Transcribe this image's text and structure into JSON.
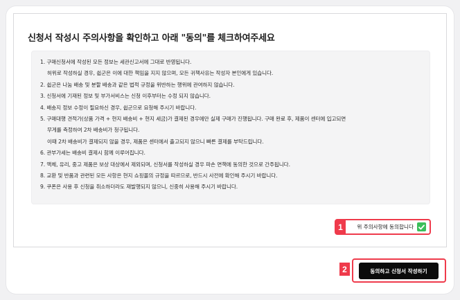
{
  "heading": "신청서 작성시 주의사항을 확인하고 아래 \"동의\"를 체크하여주세요",
  "rules": [
    {
      "line1": "1. 구매신청서에 작성된 모든 정보는 세관신고서에 그대로 반영됩니다.",
      "line2": "허위로 작성하실 경우, 쉽군은 이에 대한 책임을 지지 않으며, 모든 귀책사유는 작성자 본인에게 있습니다.",
      "line3": ""
    },
    {
      "line1": "2. 쉽군은 나눔 배송 및 분할 배송과 같은 법적 규정을 위반하는 행위에 관여하지 않습니다.",
      "line2": "",
      "line3": ""
    },
    {
      "line1": "3. 신청서에 기재된 정보 및 부가서비스는 신청 이후부터는 수정 되지 않습니다.",
      "line2": "",
      "line3": ""
    },
    {
      "line1": "4. 배송지 정보 수정이 필요하신 경우, 쉽군으로 요청해 주시기 바랍니다.",
      "line2": "",
      "line3": ""
    },
    {
      "line1": "5. 구매대행 견적가(상품 가격 + 현지 배송비 + 현지 세금)가 결제된 경우에만 실제 구매가 진행됩니다. 구매 완료 후, 제품이 센터에 입고되면",
      "line2": "무게를 측정하여 2차 배송비가 청구됩니다.",
      "line3": "이때 2차 배송비가 결제되지 않을 경우, 제품은 센터에서 출고되지 않으니 빠른 결제를 부탁드립니다."
    },
    {
      "line1": "6. 관부가세는 배송비 결제시 함께 이루어집니다.",
      "line2": "",
      "line3": ""
    },
    {
      "line1": "7. 액체, 유리, 중고 제품은 보상 대상에서 제외되며, 신청서를 작성하실 경우 파손 면책에 동의한 것으로 간주됩니다.",
      "line2": "",
      "line3": ""
    },
    {
      "line1": "8. 교환 및 반품과 관련된 모든 사항은 현지 쇼핑몰의 규정을 따르므로, 반드시 사전에 확인해 주시기 바랍니다.",
      "line2": "",
      "line3": ""
    },
    {
      "line1": "9. 쿠폰은 사용 후 신청을 취소하더라도 재발행되지 않으니, 신중히 사용해 주시기 바랍니다.",
      "line2": "",
      "line3": ""
    }
  ],
  "agree": {
    "label": "위 주의사항에 동의합니다",
    "checked": true,
    "check_icon": "check-icon"
  },
  "submit": {
    "label": "동의하고 신청서 작성하기"
  },
  "annotations": {
    "badge1": "1",
    "badge2": "2"
  },
  "colors": {
    "accent_red": "#ef3a4b",
    "check_green": "#3bbf5a",
    "button_black": "#0b0b0b"
  }
}
